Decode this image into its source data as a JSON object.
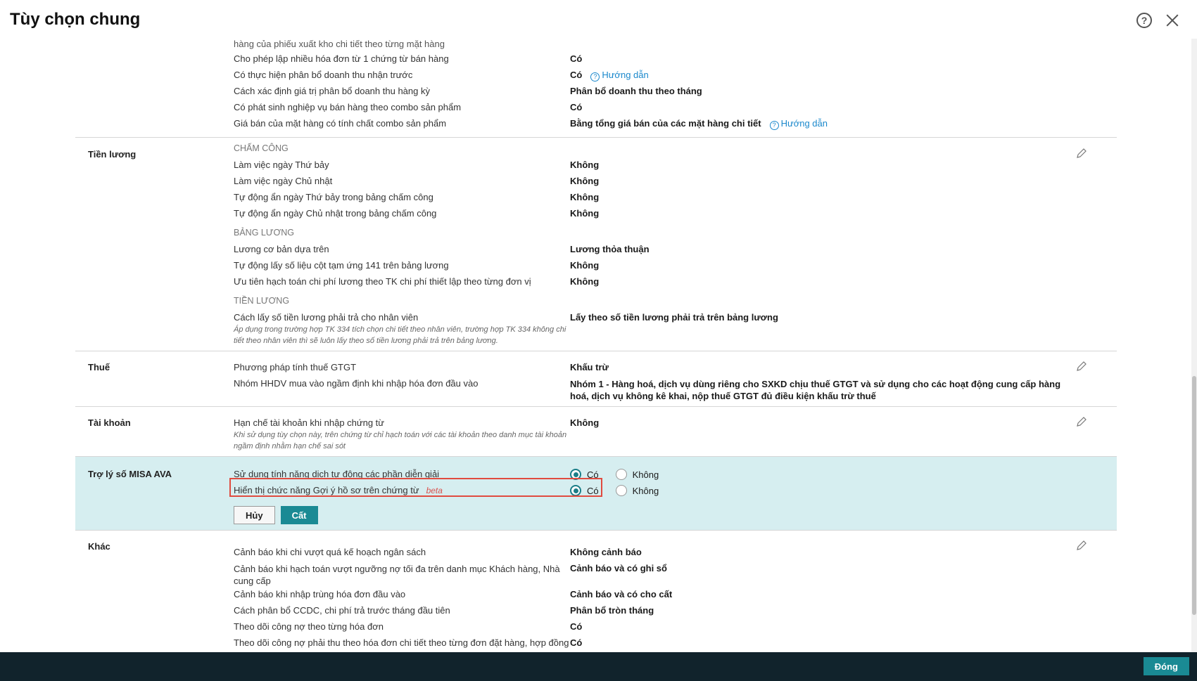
{
  "dialog": {
    "title": "Tùy chọn chung",
    "close_label": "Đóng"
  },
  "sales": {
    "rows": [
      {
        "label": "hàng của phiếu xuất kho chi tiết theo từng mặt hàng",
        "value": ""
      },
      {
        "label": "Cho phép lập nhiều hóa đơn từ 1 chứng từ bán hàng",
        "value": "Có"
      },
      {
        "label": "Có thực hiện phân bổ doanh thu nhận trước",
        "value": "Có",
        "guide": "Hướng dẫn"
      },
      {
        "label": "Cách xác định giá trị phân bổ doanh thu hàng kỳ",
        "value": "Phân bổ doanh thu theo tháng"
      },
      {
        "label": "Có phát sinh nghiệp vụ bán hàng theo combo sản phẩm",
        "value": "Có"
      },
      {
        "label": "Giá bán của mặt hàng có tính chất combo sản phẩm",
        "value": "Bằng tổng giá bán của các mặt hàng chi tiết",
        "guide": "Hướng dẫn"
      }
    ]
  },
  "salary": {
    "name": "Tiền lương",
    "group1": "CHẤM CÔNG",
    "rows1": [
      {
        "label": "Làm việc ngày Thứ bảy",
        "value": "Không"
      },
      {
        "label": "Làm việc ngày Chủ nhật",
        "value": "Không"
      },
      {
        "label": "Tự động ẩn ngày Thứ bảy trong bảng chấm công",
        "value": "Không"
      },
      {
        "label": "Tự động ẩn ngày Chủ nhật trong bảng chấm công",
        "value": "Không"
      }
    ],
    "group2": "BẢNG LƯƠNG",
    "rows2": [
      {
        "label": "Lương cơ bản dựa trên",
        "value": "Lương thỏa thuận"
      },
      {
        "label": "Tự động lấy số liệu cột tạm ứng 141 trên bảng lương",
        "value": "Không"
      },
      {
        "label": "Ưu tiên hạch toán chi phí lương theo TK chi phí thiết lập theo từng đơn vị",
        "value": "Không"
      }
    ],
    "group3": "TIỀN LƯƠNG",
    "rows3": [
      {
        "label": "Cách lấy số tiền lương phải trả cho nhân viên",
        "value": "Lấy theo số tiền lương phải trả trên bảng lương",
        "note": "Áp dụng trong trường hợp TK 334 tích chọn chi tiết theo nhân viên, trường hợp TK 334 không chi tiết theo nhân viên thì sẽ luôn lấy theo số tiền lương phải trả trên bảng lương."
      }
    ]
  },
  "tax": {
    "name": "Thuế",
    "rows": [
      {
        "label": "Phương pháp tính thuế GTGT",
        "value": "Khấu trừ"
      },
      {
        "label": "Nhóm HHDV mua vào ngầm định khi nhập hóa đơn đầu vào",
        "value": "Nhóm 1 - Hàng hoá, dịch vụ dùng riêng cho SXKD chịu thuế GTGT và sử dụng cho các hoạt động cung cấp hàng hoá, dịch vụ không kê khai, nộp thuế GTGT đủ điều kiện khấu trừ thuế"
      }
    ]
  },
  "account": {
    "name": "Tài khoản",
    "rows": [
      {
        "label": "Hạn chế tài khoản khi nhập chứng từ",
        "value": "Không",
        "note": "Khi sử dụng tùy chọn này, trên chứng từ chỉ hạch toán với các tài khoản theo danh mục tài khoản ngầm định nhằm hạn chế sai sót"
      }
    ]
  },
  "ava": {
    "name": "Trợ lý số MISA AVA",
    "row1": {
      "label": "Sử dụng tính năng dịch tự động các phần diễn giải",
      "opt_yes": "Có",
      "opt_no": "Không"
    },
    "row2": {
      "label": "Hiển thị chức năng Gợi ý hồ sơ trên chứng từ",
      "beta": "beta",
      "opt_yes": "Có",
      "opt_no": "Không"
    },
    "cancel_label": "Hủy",
    "save_label": "Cất"
  },
  "other": {
    "name": "Khác",
    "rows": [
      {
        "label": "Cảnh báo khi chi vượt quá kế hoạch ngân sách",
        "value": "Không cảnh báo"
      },
      {
        "label": "Cảnh báo khi hạch toán vượt ngưỡng nợ tối đa trên danh mục Khách hàng, Nhà cung cấp",
        "value": "Cảnh báo và có ghi sổ"
      },
      {
        "label": "Cảnh báo khi nhập trùng hóa đơn đầu vào",
        "value": "Cảnh báo và có cho cất"
      },
      {
        "label": "Cách phân bổ CCDC, chi phí trả trước tháng đầu tiên",
        "value": "Phân bổ tròn tháng"
      },
      {
        "label": "Theo dõi công nợ theo từng hóa đơn",
        "value": "Có"
      },
      {
        "label": "Theo dõi công nợ phải thu theo hóa đơn chi tiết theo từng đơn đặt hàng, hợp đồng",
        "value": "Có"
      }
    ]
  }
}
